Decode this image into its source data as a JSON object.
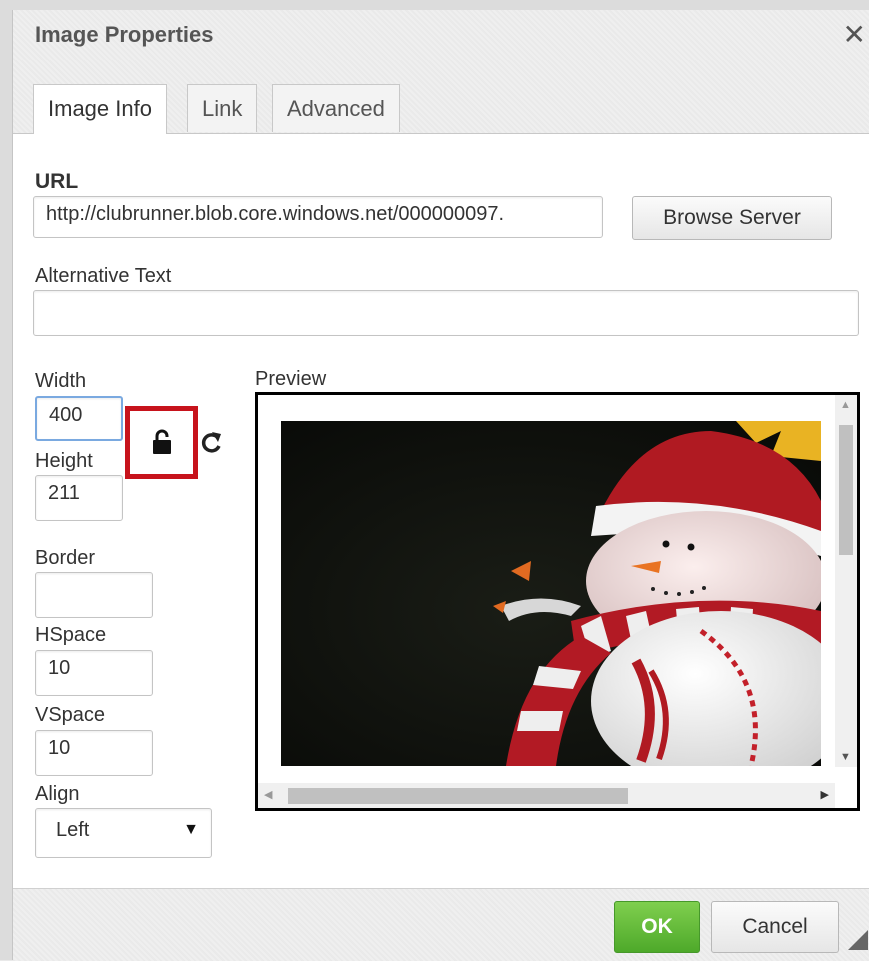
{
  "dialog": {
    "title": "Image Properties",
    "close_glyph": "✕"
  },
  "tabs": [
    {
      "label": "Image Info",
      "active": true
    },
    {
      "label": "Link",
      "active": false
    },
    {
      "label": "Advanced",
      "active": false
    }
  ],
  "form": {
    "url_label": "URL",
    "url_value": "http://clubrunner.blob.core.windows.net/000000097.",
    "browse_label": "Browse Server",
    "alt_label": "Alternative Text",
    "alt_value": "",
    "width_label": "Width",
    "width_value": "400",
    "height_label": "Height",
    "height_value": "211",
    "border_label": "Border",
    "border_value": "",
    "hspace_label": "HSpace",
    "hspace_value": "10",
    "vspace_label": "VSpace",
    "vspace_value": "10",
    "align_label": "Align",
    "align_value": "Left",
    "align_caret": "▼",
    "lock_icon": "lock-open-icon",
    "reset_icon": "refresh-icon",
    "highlight_color": "#c7131c"
  },
  "preview": {
    "label": "Preview",
    "image_subject": "snowman-ornament-photo"
  },
  "footer": {
    "ok_label": "OK",
    "cancel_label": "Cancel"
  }
}
